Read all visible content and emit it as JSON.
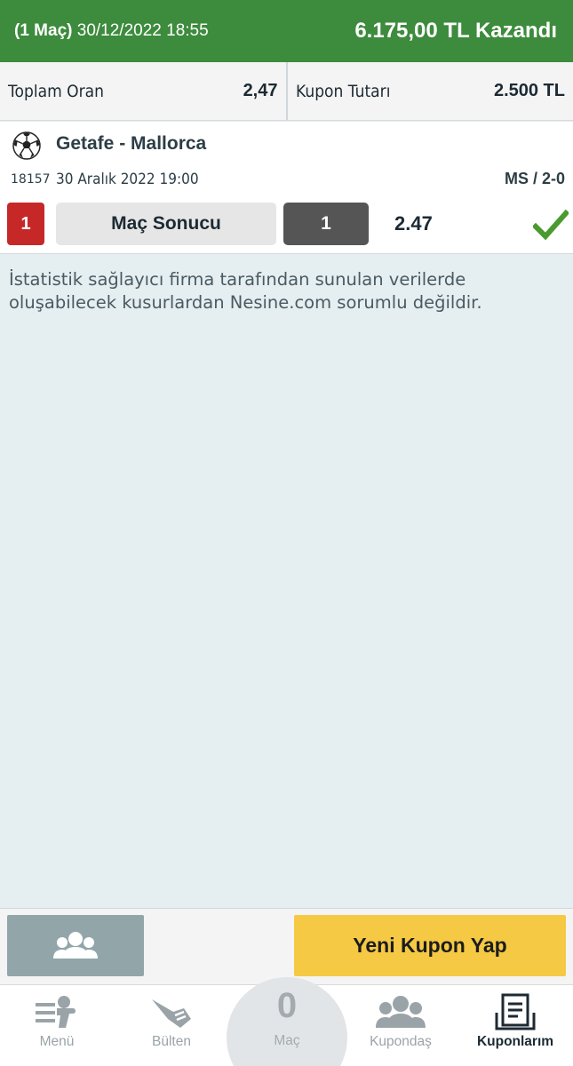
{
  "header": {
    "match_count": "(1 Maç)",
    "datetime": "30/12/2022 18:55",
    "result": "6.175,00 TL Kazandı"
  },
  "summary": {
    "total_odds_label": "Toplam Oran",
    "total_odds_value": "2,47",
    "stake_label": "Kupon Tutarı",
    "stake_value": "2.500 TL"
  },
  "match": {
    "teams": "Getafe - Mallorca",
    "code": "18157",
    "date": "30 Aralık 2022 19:00",
    "score": "MS / 2-0",
    "mbs": "1",
    "market": "Maç Sonucu",
    "pick": "1",
    "odd": "2.47",
    "status_icon": "check-icon",
    "status_color": "#4a9a2f"
  },
  "disclaimer": "İstatistik sağlayıcı firma tarafından sunulan verilerde oluşabilecek kusurlardan Nesine.com sorumlu değildir.",
  "actions": {
    "share_icon": "group-icon",
    "new_coupon": "Yeni Kupon Yap"
  },
  "tabbar": {
    "menu": "Menü",
    "bulletin": "Bülten",
    "match_count": "0",
    "match_label": "Maç",
    "kupon. Kuponda": "",
    "kupondas": "Kupondaş",
    "coupons": "Kuponlarım"
  },
  "colors": {
    "header_green": "#3d8b3d",
    "accent_yellow": "#f5c944",
    "badge_red": "#c62828"
  }
}
